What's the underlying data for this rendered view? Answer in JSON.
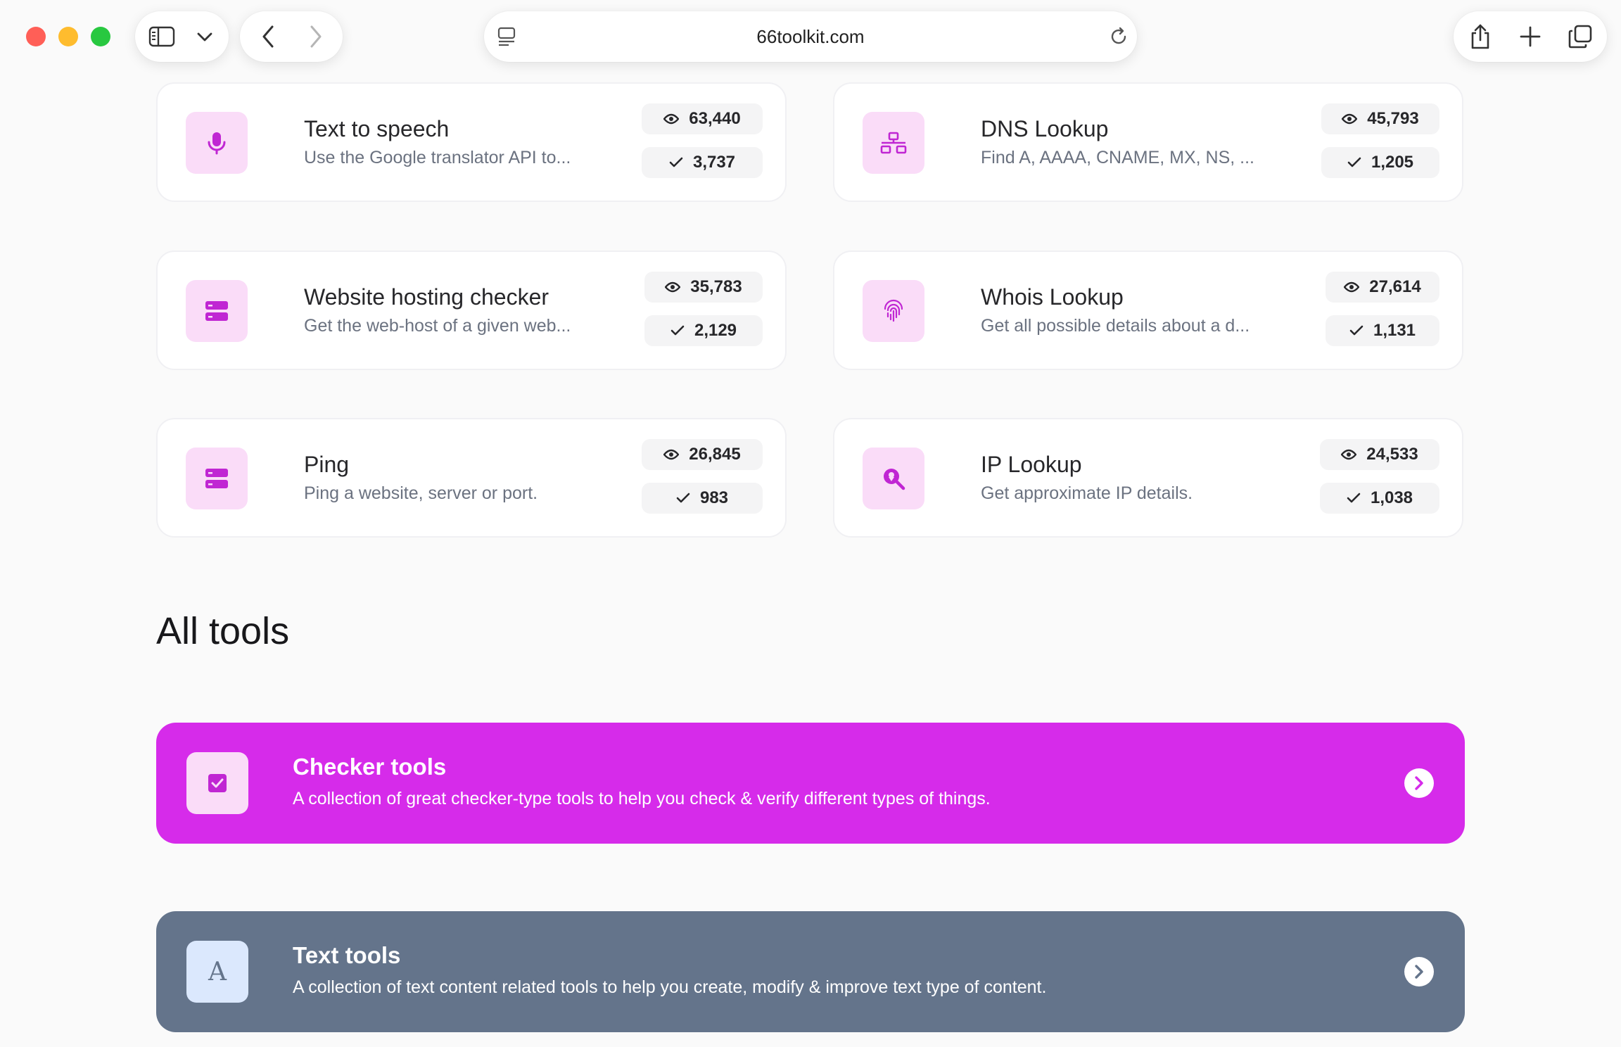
{
  "browser": {
    "url": "66toolkit.com"
  },
  "colors": {
    "brand_accent": "#d62bea",
    "icon_tint": "#fadcf8",
    "text_tools_color": "#64748b"
  },
  "cards": [
    {
      "title": "Text to speech",
      "description": "Use the Google translator API to...",
      "views": "63,440",
      "uses": "3,737",
      "icon": "microphone-icon"
    },
    {
      "title": "DNS Lookup",
      "description": "Find A, AAAA, CNAME, MX, NS, ...",
      "views": "45,793",
      "uses": "1,205",
      "icon": "network-icon"
    },
    {
      "title": "Website hosting checker",
      "description": "Get the web-host of a given web...",
      "views": "35,783",
      "uses": "2,129",
      "icon": "server-icon"
    },
    {
      "title": "Whois Lookup",
      "description": "Get all possible details about a d...",
      "views": "27,614",
      "uses": "1,131",
      "icon": "fingerprint-icon"
    },
    {
      "title": "Ping",
      "description": "Ping a website, server or port.",
      "views": "26,845",
      "uses": "983",
      "icon": "server-icon"
    },
    {
      "title": "IP Lookup",
      "description": "Get approximate IP details.",
      "views": "24,533",
      "uses": "1,038",
      "icon": "location-search-icon"
    }
  ],
  "all_tools": {
    "heading": "All tools",
    "categories": [
      {
        "title": "Checker tools",
        "description": "A collection of great checker-type tools to help you check & verify different types of things.",
        "icon": "checkbox-icon"
      },
      {
        "title": "Text tools",
        "description": "A collection of text content related tools to help you create, modify & improve text type of content.",
        "icon": "letter-a-icon",
        "icon_letter": "A"
      }
    ]
  }
}
